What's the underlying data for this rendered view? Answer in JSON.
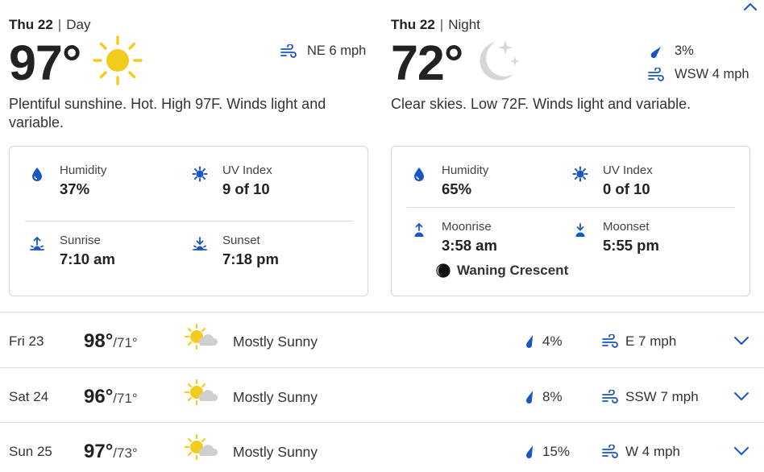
{
  "colors": {
    "accent": "#1a56c2",
    "sun": "#f2cc1d",
    "moon": "#d4d4d4",
    "cloud": "#c9c9c9",
    "text": "#252525",
    "border": "#d6d6d6"
  },
  "icons": {
    "collapse": "chevron-up-icon",
    "wind": "wind-icon",
    "precip": "raindrop-icon",
    "humidity": "humidity-drop-icon",
    "uv": "uv-sun-icon",
    "sunrise": "sunrise-icon",
    "sunset": "sunset-icon",
    "moonrise": "moonrise-icon",
    "moonset": "moonset-icon",
    "moonphase": "waning-crescent-icon",
    "expand": "chevron-down-icon"
  },
  "day": {
    "date": "Thu 22",
    "period": "Day",
    "temp": "97°",
    "condition_icon": "sunny-icon",
    "wind": "NE 6 mph",
    "summary": "Plentiful sunshine. Hot. High 97F. Winds light and variable.",
    "details": {
      "humidity_label": "Humidity",
      "humidity_value": "37%",
      "uv_label": "UV Index",
      "uv_value": "9 of 10",
      "sunrise_label": "Sunrise",
      "sunrise_value": "7:10 am",
      "sunset_label": "Sunset",
      "sunset_value": "7:18 pm"
    }
  },
  "night": {
    "date": "Thu 22",
    "period": "Night",
    "temp": "72°",
    "condition_icon": "clear-night-icon",
    "precip": "3%",
    "wind": "WSW 4 mph",
    "summary": "Clear skies. Low 72F. Winds light and variable.",
    "details": {
      "humidity_label": "Humidity",
      "humidity_value": "65%",
      "uv_label": "UV Index",
      "uv_value": "0 of 10",
      "moonrise_label": "Moonrise",
      "moonrise_value": "3:58 am",
      "moonset_label": "Moonset",
      "moonset_value": "5:55 pm",
      "moon_phase": "Waning Crescent"
    }
  },
  "forecast": [
    {
      "date": "Fri 23",
      "high": "98°",
      "low": "/71°",
      "icon": "mostly-sunny-icon",
      "condition": "Mostly Sunny",
      "precip": "4%",
      "wind": "E 7 mph"
    },
    {
      "date": "Sat 24",
      "high": "96°",
      "low": "/71°",
      "icon": "mostly-sunny-icon",
      "condition": "Mostly Sunny",
      "precip": "8%",
      "wind": "SSW 7 mph"
    },
    {
      "date": "Sun 25",
      "high": "97°",
      "low": "/73°",
      "icon": "mostly-sunny-icon",
      "condition": "Mostly Sunny",
      "precip": "15%",
      "wind": "W 4 mph"
    }
  ]
}
